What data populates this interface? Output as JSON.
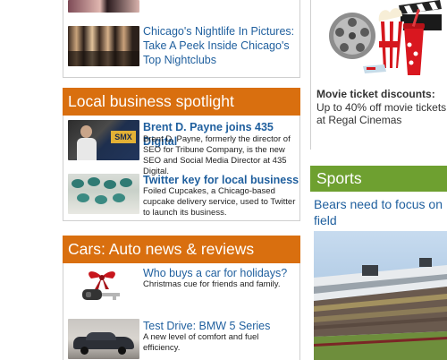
{
  "nightlife": {
    "title": "Chicago's Nightlife In Pictures: Take A Peek Inside Chicago's Top Nightclubs"
  },
  "spotlight": {
    "heading": "Local business spotlight",
    "items": [
      {
        "title": "Brent D. Payne joins 435 Digital",
        "desc": "Brent D. Payne, formerly the director of SEO for Tribune Company, is the new SEO and Social Media Director at 435 Digital."
      },
      {
        "title": "Twitter key for local business",
        "desc": "Foiled Cupcakes, a Chicago-based cupcake delivery service, used to Twitter to launch its business."
      }
    ]
  },
  "cars": {
    "heading": "Cars: Auto news & reviews",
    "items": [
      {
        "title": "Who buys a car for holidays?",
        "desc": "Christmas cue for friends and family."
      },
      {
        "title": "Test Drive: BMW 5 Series",
        "desc": "A new level of comfort and fuel efficiency."
      }
    ]
  },
  "promo": {
    "bold": "Movie ticket discounts:",
    "text": " Up to 40% off movie tickets at Regal Cinemas"
  },
  "sports": {
    "heading": "Sports",
    "headline": "Bears need to focus on field"
  },
  "colors": {
    "orange_header": "#d96f0f",
    "green_header": "#6ea030",
    "link_blue": "#1f5f9e"
  }
}
